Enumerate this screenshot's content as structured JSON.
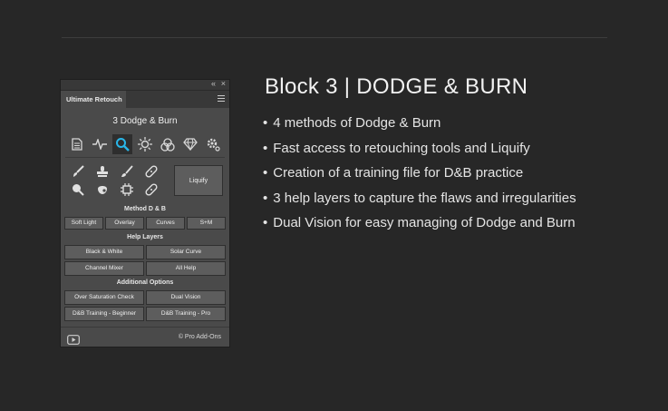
{
  "panel": {
    "window_controls": {
      "collapse": "«",
      "close": "×"
    },
    "tab_label": "Ultimate Retouch",
    "title": "3 Dodge & Burn",
    "tool_tabs": [
      "layers-doc-icon",
      "heartbeat-icon",
      "search-icon",
      "sun-brightness-icon",
      "color-circles-icon",
      "diamond-icon",
      "gear-icon"
    ],
    "active_tool_tab": "search-icon",
    "tools": [
      "dodge-brush-icon",
      "stamp-icon",
      "brush-icon",
      "bandage-icon",
      "sponge-icon",
      "patch-icon",
      "chip-icon",
      "bandage-icon"
    ],
    "liquify_label": "Liquify",
    "method_title": "Method D & B",
    "method_buttons": [
      "Soft Light",
      "Overlay",
      "Curves",
      "S+M"
    ],
    "help_title": "Help Layers",
    "help_buttons": [
      "Black & White",
      "Solar Curve",
      "Channel Mixer",
      "All Help"
    ],
    "additional_title": "Additional Options",
    "additional_buttons": [
      "Over Saturation Check",
      "Dual Vision",
      "D&B Training - Beginner",
      "D&B Training - Pro"
    ],
    "footer_credit": "© Pro Add-Ons",
    "accent_color": "#29b6e8"
  },
  "headline": "Block 3 | DODGE & BURN",
  "features": [
    "4 methods of Dodge & Burn",
    "Fast access to retouching tools and Liquify",
    "Creation of a training file for D&B practice",
    "3 help layers to capture the flaws and irregularities",
    "Dual Vision for easy managing of Dodge and Burn"
  ],
  "bullet": "•"
}
